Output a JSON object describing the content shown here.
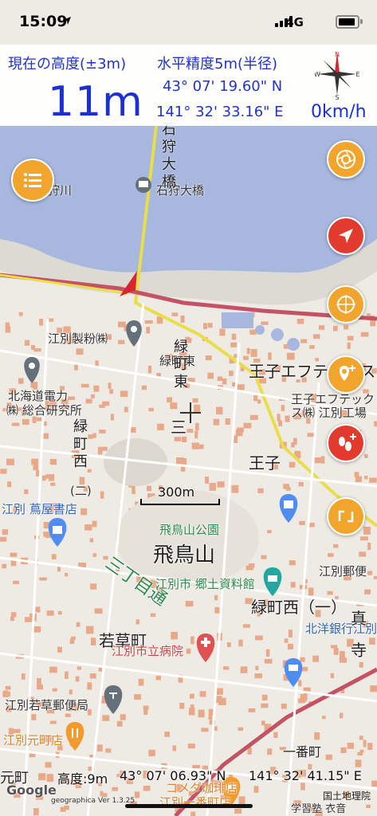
{
  "status_bar": {
    "time": "15:09",
    "network": "4G"
  },
  "header": {
    "altitude_label": "現在の高度(±3m)",
    "altitude": "11m",
    "accuracy_label": "水平精度5m(半径)",
    "latitude": "43° 07' 19.60\" N",
    "longitude": "141° 32' 33.16\" E",
    "speed": "0km/h",
    "compass_marks": {
      "n": "N",
      "s": "S",
      "e": "E",
      "w": "W"
    }
  },
  "map": {
    "labels": {
      "ishikari_river": "狩川",
      "ishikari_ohashi": "石狩大橋",
      "bridge_vertical": "石狩大橋",
      "ebetsu_seishi": "江別製粉㈱",
      "hokkaido_electric": "北海道電力",
      "research_institute": "㈱ 総合研究所",
      "midorimachi_higashi": "緑町東",
      "midorimachi_higashi_vertical": "緑町東",
      "midorimachi_san": "三",
      "midorimachi_nishi_vertical": "緑町西",
      "midorimachi_ni": "(二)",
      "oji_f_tex": "王子エフテックス",
      "oji_f_tex_factory_1": "王子エフテック",
      "oji_f_tex_factory_2": "ス㈱ 江別工場",
      "oji": "王子",
      "tsutaya": "江別 蔦屋書店",
      "asukayama_park": "飛鳥山公園",
      "asukayama": "飛鳥山",
      "sanchome_dori": "三丁目通",
      "kyodo_museum": "江別市 郷土資料館",
      "midorimachi_nishi_ichi": "緑町西（一）",
      "post_office_right": "江別郵便",
      "hokuyo_bank": "北洋銀行江別",
      "wakakusa": "若草町",
      "city_hospital": "江別市立病院",
      "wakakusa_post": "江別若草郵便局",
      "motomachi_store": "江別元町店",
      "motomachi": "元町",
      "komeda": "コメダ珈琲店",
      "ichibancho_store": "江別一番町店",
      "ichibancho": "一番町",
      "shin": "真",
      "tera": "寺",
      "gakushu": "学習塾 衣音"
    },
    "scale_label": "300m"
  },
  "buttons": {
    "menu": "menu",
    "right": [
      "overlay-layers",
      "current-location",
      "target-center",
      "place-marker",
      "footprint-track",
      "route-toggle"
    ]
  },
  "footer": {
    "altitude": "高度:9m",
    "latitude": "43° 07' 06.93\" N",
    "longitude": "141° 32' 41.15\" E",
    "google": "Google",
    "version": "geographica Ver 1.3.25",
    "attribution": "国土地理院"
  },
  "colors": {
    "river": "#a7b7de",
    "land": "#eeeae4",
    "building": "#e8a98a",
    "road_yellow": "#e8de4a",
    "road_red": "#c25264",
    "header_text": "#2233cc",
    "fab_orange": "#f2a52c",
    "fab_red": "#e23b2e"
  }
}
